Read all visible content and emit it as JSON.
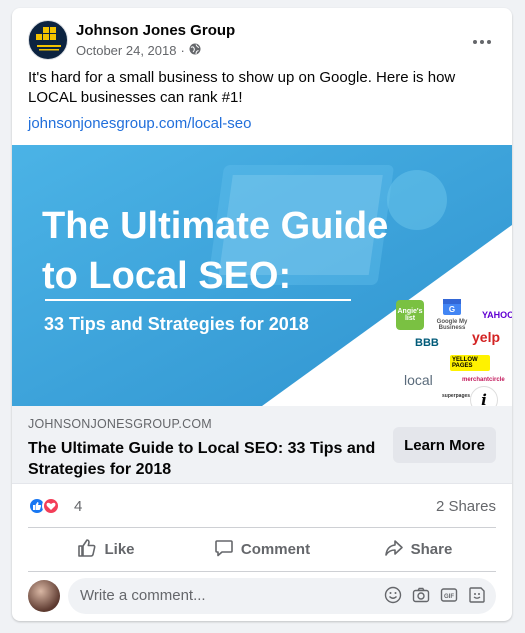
{
  "post": {
    "author": "Johnson Jones Group",
    "date": "October 24, 2018",
    "date_separator": "·",
    "privacy_icon": "globe-icon",
    "more_icon": "more-icon",
    "text": "It's hard for a small business to show up on Google. Here is how LOCAL businesses can rank #1!",
    "link_text": "johnsonjonesgroup.com/local-seo"
  },
  "hero": {
    "title": "The Ultimate Guide\nto Local SEO:",
    "subtitle": "33 Tips and Strategies for 2018",
    "logos": [
      "Angie's list",
      "Google My Business",
      "YAHOO!",
      "BBB",
      "yelp",
      "YELLOW PAGES",
      "local",
      "merchantcircle",
      "superpages.com"
    ],
    "info_label": "i"
  },
  "link_preview": {
    "domain": "JOHNSONJONESGROUP.COM",
    "title": "The Ultimate Guide to Local SEO: 33 Tips and Strategies for 2018",
    "cta": "Learn More"
  },
  "engagement": {
    "reaction_count": "4",
    "reaction_icons": [
      "like-reaction-icon",
      "love-reaction-icon"
    ],
    "shares": "2 Shares"
  },
  "actions": [
    {
      "name": "like",
      "label": "Like",
      "icon": "thumbs-up-icon"
    },
    {
      "name": "comment",
      "label": "Comment",
      "icon": "comment-icon"
    },
    {
      "name": "share",
      "label": "Share",
      "icon": "share-icon"
    }
  ],
  "comment": {
    "placeholder": "Write a comment...",
    "tool_icons": [
      "emoji-icon",
      "camera-icon",
      "gif-icon",
      "sticker-icon"
    ]
  },
  "colors": {
    "link": "#216fdb",
    "like_blue": "#1877f2",
    "love_red": "#f33e58",
    "hero_blue": "#35a3de"
  }
}
